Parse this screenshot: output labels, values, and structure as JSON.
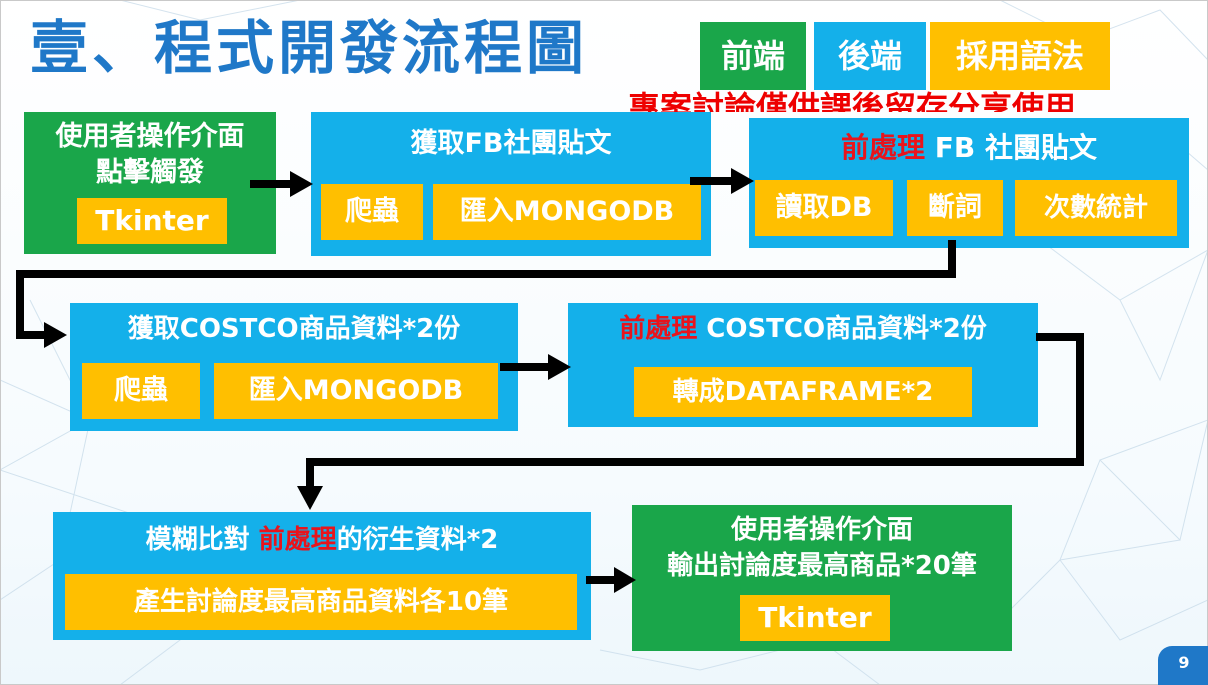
{
  "title": "壹、程式開發流程圖",
  "legend": {
    "frontend": "前端",
    "backend": "後端",
    "syntax": "採用語法"
  },
  "note": "專案討論僅供課後留存分享使用",
  "boxes": {
    "ui_trigger": {
      "line1": "使用者操作介面",
      "line2": "點擊觸發",
      "chip": "Tkinter"
    },
    "fb_fetch": {
      "title": "獲取FB社團貼文",
      "chips": [
        "爬蟲",
        "匯入MONGODB"
      ]
    },
    "fb_preprocess": {
      "title_prefix": "前處理",
      "title_rest": " FB 社團貼文",
      "chips": [
        "讀取DB",
        "斷詞",
        "次數統計"
      ]
    },
    "costco_fetch": {
      "title": "獲取COSTCO商品資料*2份",
      "chips": [
        "爬蟲",
        "匯入MONGODB"
      ]
    },
    "costco_preprocess": {
      "title_prefix": "前處理",
      "title_rest": " COSTCO商品資料*2份",
      "chip": "轉成DATAFRAME*2"
    },
    "fuzzy_match": {
      "title_prefix": "模糊比對 ",
      "title_red": "前處理",
      "title_suffix": "的衍生資料*2",
      "chip": "產生討論度最高商品資料各10筆"
    },
    "ui_output": {
      "line1": "使用者操作介面",
      "line2": "輸出討論度最高商品*20筆",
      "chip": "Tkinter"
    }
  },
  "page_number": "9",
  "colors": {
    "title": "#1f78c8",
    "frontend": "#1aa64a",
    "backend": "#14b0ea",
    "syntax": "#ffbf00",
    "highlight": "#e8141c",
    "arrow": "#000000"
  }
}
